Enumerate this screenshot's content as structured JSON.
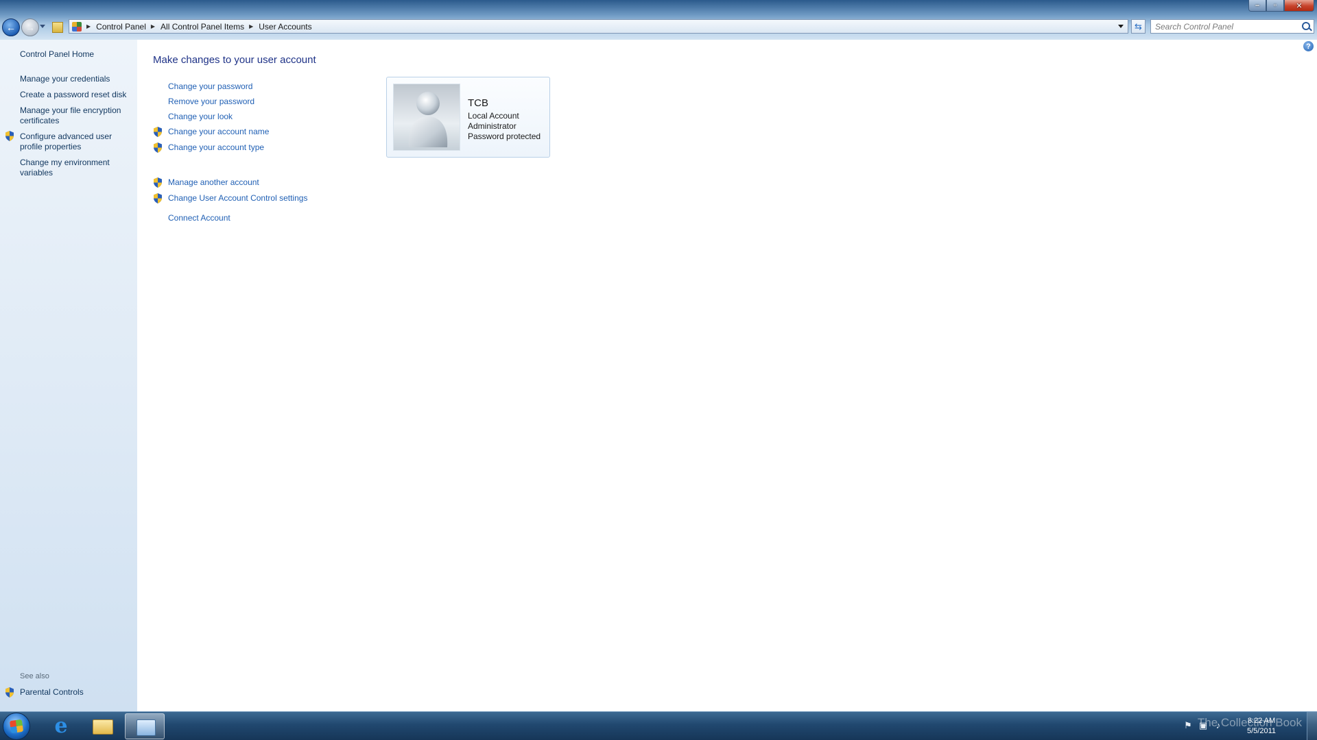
{
  "window": {
    "controls": {
      "minimize": "–",
      "maximize": "▫",
      "close": "✕"
    }
  },
  "nav": {
    "back": "←",
    "forward": "→",
    "breadcrumbs": [
      "Control Panel",
      "All Control Panel Items",
      "User Accounts"
    ],
    "refresh": "⇆",
    "search_placeholder": "Search Control Panel"
  },
  "sidebar": {
    "home": "Control Panel Home",
    "links": [
      "Manage your credentials",
      "Create a password reset disk",
      "Manage your file encryption certificates",
      "Configure advanced user profile properties",
      "Change my environment variables"
    ],
    "see_also_heading": "See also",
    "see_also_links": [
      "Parental Controls"
    ]
  },
  "help": "?",
  "main": {
    "title": "Make changes to your user account",
    "tasks": [
      "Change your password",
      "Remove your password",
      "Change your look",
      "Change your account name",
      "Change your account type"
    ],
    "more_tasks": [
      "Manage another account",
      "Change User Account Control settings"
    ],
    "connect": "Connect Account"
  },
  "account": {
    "name": "TCB",
    "type": "Local Account",
    "role": "Administrator",
    "status": "Password protected"
  },
  "taskbar": {
    "ie_glyph": "e",
    "clock_time": "8:22 AM",
    "clock_date": "5/5/2011",
    "watermark": "The Collection Book"
  },
  "colors": {
    "link": "#1f5fb4",
    "sidebar_link": "#10365e",
    "title": "#1e3287",
    "shield_blue": "#2a5fb8",
    "shield_yellow": "#f2c12e"
  }
}
